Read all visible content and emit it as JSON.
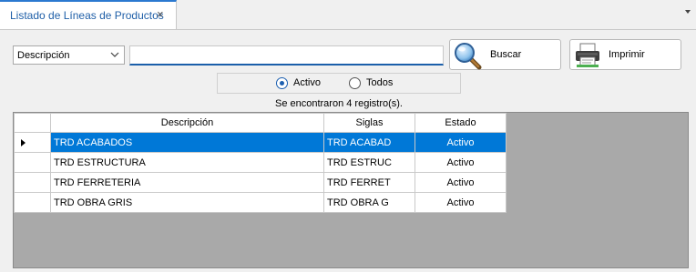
{
  "tab": {
    "title": "Listado de Líneas de Productos",
    "close": "×"
  },
  "search": {
    "field_selected": "Descripción",
    "query_value": "",
    "buscar_label": "Buscar",
    "imprimir_label": "Imprimir"
  },
  "filter": {
    "options": [
      {
        "label": "Activo",
        "checked": true
      },
      {
        "label": "Todos",
        "checked": false
      }
    ]
  },
  "status": {
    "record_count_text": "Se encontraron 4 registro(s)."
  },
  "grid": {
    "columns": [
      "Descripción",
      "Siglas",
      "Estado"
    ],
    "rows": [
      {
        "descripcion": "TRD ACABADOS",
        "siglas": "TRD ACABAD",
        "estado": "Activo"
      },
      {
        "descripcion": "TRD ESTRUCTURA",
        "siglas": "TRD ESTRUC",
        "estado": "Activo"
      },
      {
        "descripcion": "TRD FERRETERIA",
        "siglas": "TRD FERRET",
        "estado": "Activo"
      },
      {
        "descripcion": "TRD OBRA GRIS",
        "siglas": "TRD OBRA G",
        "estado": "Activo"
      }
    ],
    "selected_row": 0
  },
  "colors": {
    "accent": "#0078d7",
    "tab_text": "#1f5fa8",
    "grid_empty": "#a9a9a9"
  },
  "icons": {
    "buscar": "magnifier-icon",
    "imprimir": "printer-icon",
    "combo": "chevron-down-icon",
    "tab_menu": "caret-down-icon"
  }
}
